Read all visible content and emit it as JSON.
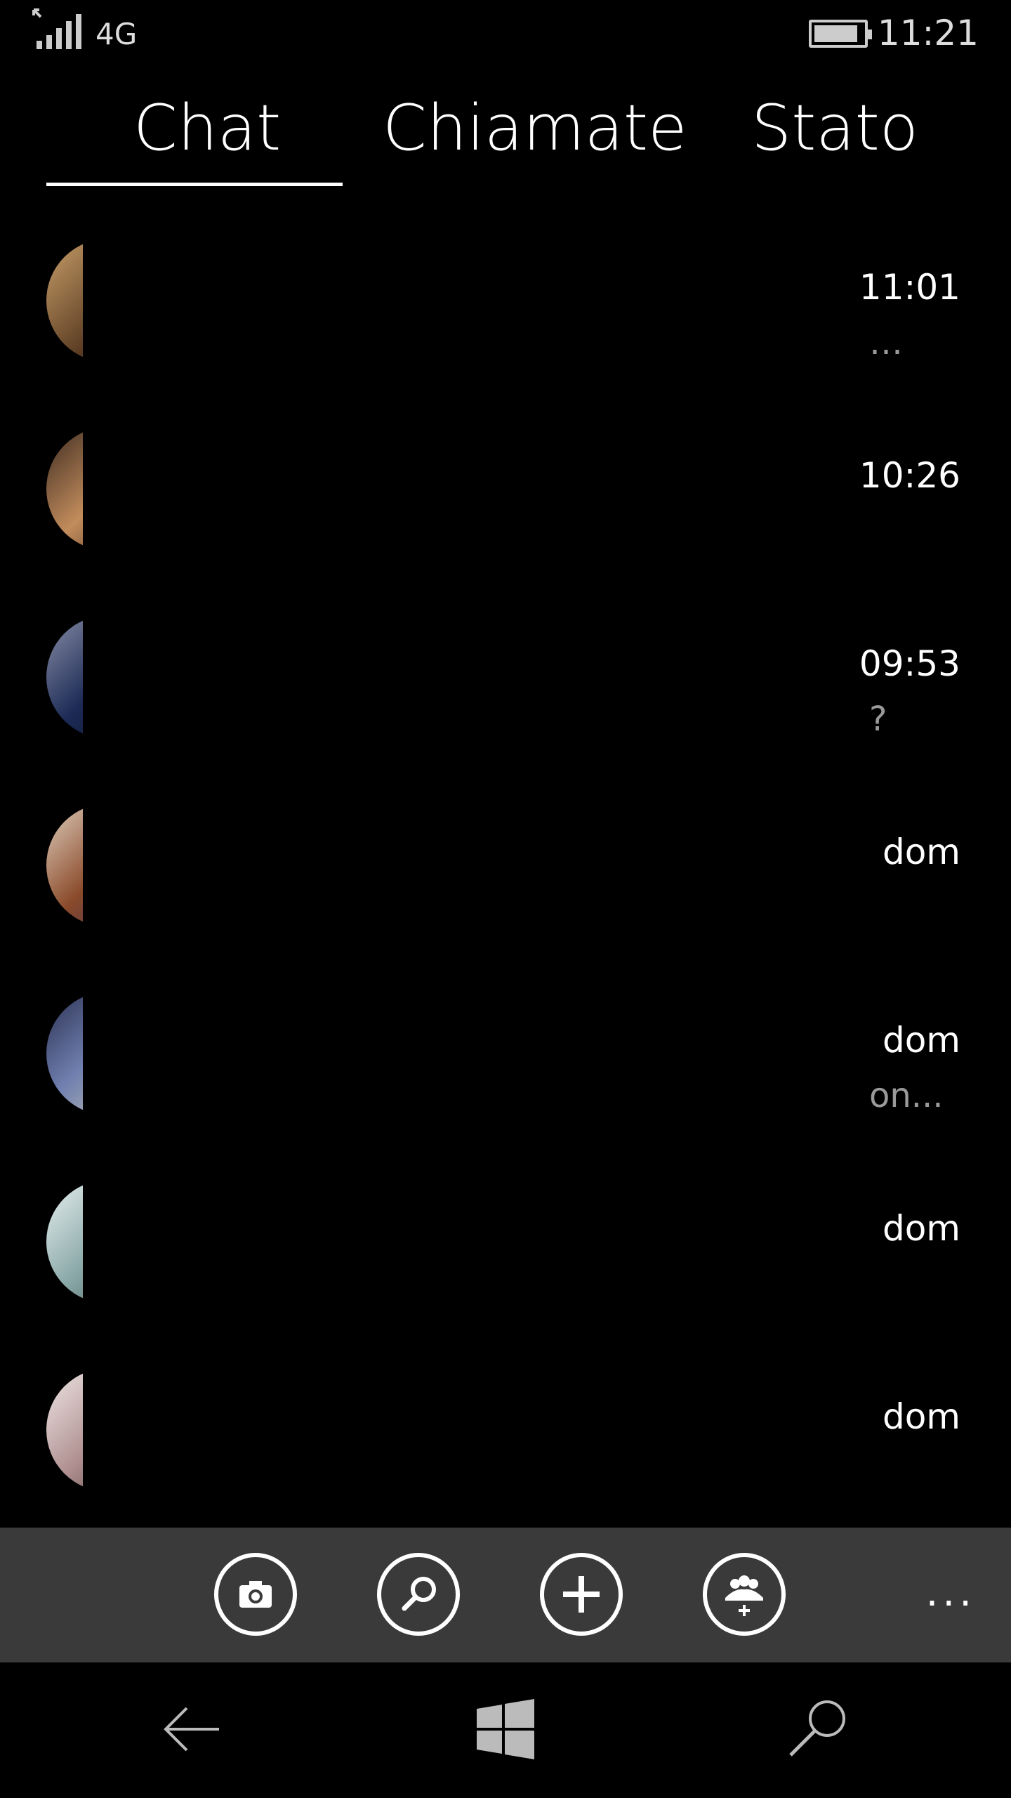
{
  "status_bar": {
    "network": "4G",
    "time": "11:21",
    "signal_icon": "signal-bars-icon",
    "battery_icon": "battery-icon",
    "battery_level": 0.9
  },
  "tabs": [
    {
      "label": "Chat",
      "selected": true
    },
    {
      "label": "Chiamate",
      "selected": false
    },
    {
      "label": "Stato",
      "selected": false
    }
  ],
  "chats": [
    {
      "time": "11:01",
      "preview": "…"
    },
    {
      "time": "10:26",
      "preview": ""
    },
    {
      "time": "09:53",
      "preview": "?"
    },
    {
      "time": "dom",
      "preview": ""
    },
    {
      "time": "dom",
      "preview": "on..."
    },
    {
      "time": "dom",
      "preview": ""
    },
    {
      "time": "dom",
      "preview": ""
    }
  ],
  "app_bar": {
    "buttons": [
      {
        "name": "camera-button",
        "icon": "camera-icon"
      },
      {
        "name": "search-button",
        "icon": "search-icon"
      },
      {
        "name": "new-chat-button",
        "icon": "plus-icon"
      },
      {
        "name": "new-group-button",
        "icon": "group-add-icon"
      }
    ],
    "more_label": "..."
  },
  "nav_bar": {
    "buttons": [
      {
        "name": "back-button",
        "icon": "back-arrow-icon"
      },
      {
        "name": "start-button",
        "icon": "windows-logo-icon"
      },
      {
        "name": "search-nav-button",
        "icon": "search-icon"
      }
    ]
  },
  "colors": {
    "background": "#000000",
    "app_bar": "#3a3a3a",
    "preview_text": "#9a9a9a"
  }
}
